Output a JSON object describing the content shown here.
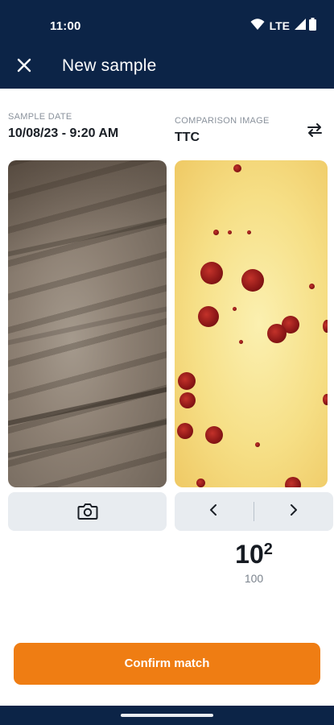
{
  "status_bar": {
    "time": "11:00",
    "network": "LTE",
    "icons": [
      "wifi-icon",
      "signal-icon",
      "battery-icon"
    ]
  },
  "app_bar": {
    "title": "New sample",
    "close_icon": "close-icon"
  },
  "sample_date": {
    "label": "SAMPLE DATE",
    "value": "10/08/23 - 9:20 AM"
  },
  "comparison_image": {
    "label": "COMPARISON IMAGE",
    "value": "TTC",
    "swap_icon": "swap-icon"
  },
  "camera": {
    "icon": "camera-icon"
  },
  "navigation": {
    "prev_icon": "chevron-left-icon",
    "next_icon": "chevron-right-icon"
  },
  "dilution": {
    "base": "10",
    "exponent": "2",
    "value": "100"
  },
  "confirm_button": {
    "label": "Confirm match",
    "color": "#ef7d13"
  },
  "colors": {
    "header": "#0c2447",
    "accent": "#ef7d13",
    "tile": "#e8ecf0"
  }
}
